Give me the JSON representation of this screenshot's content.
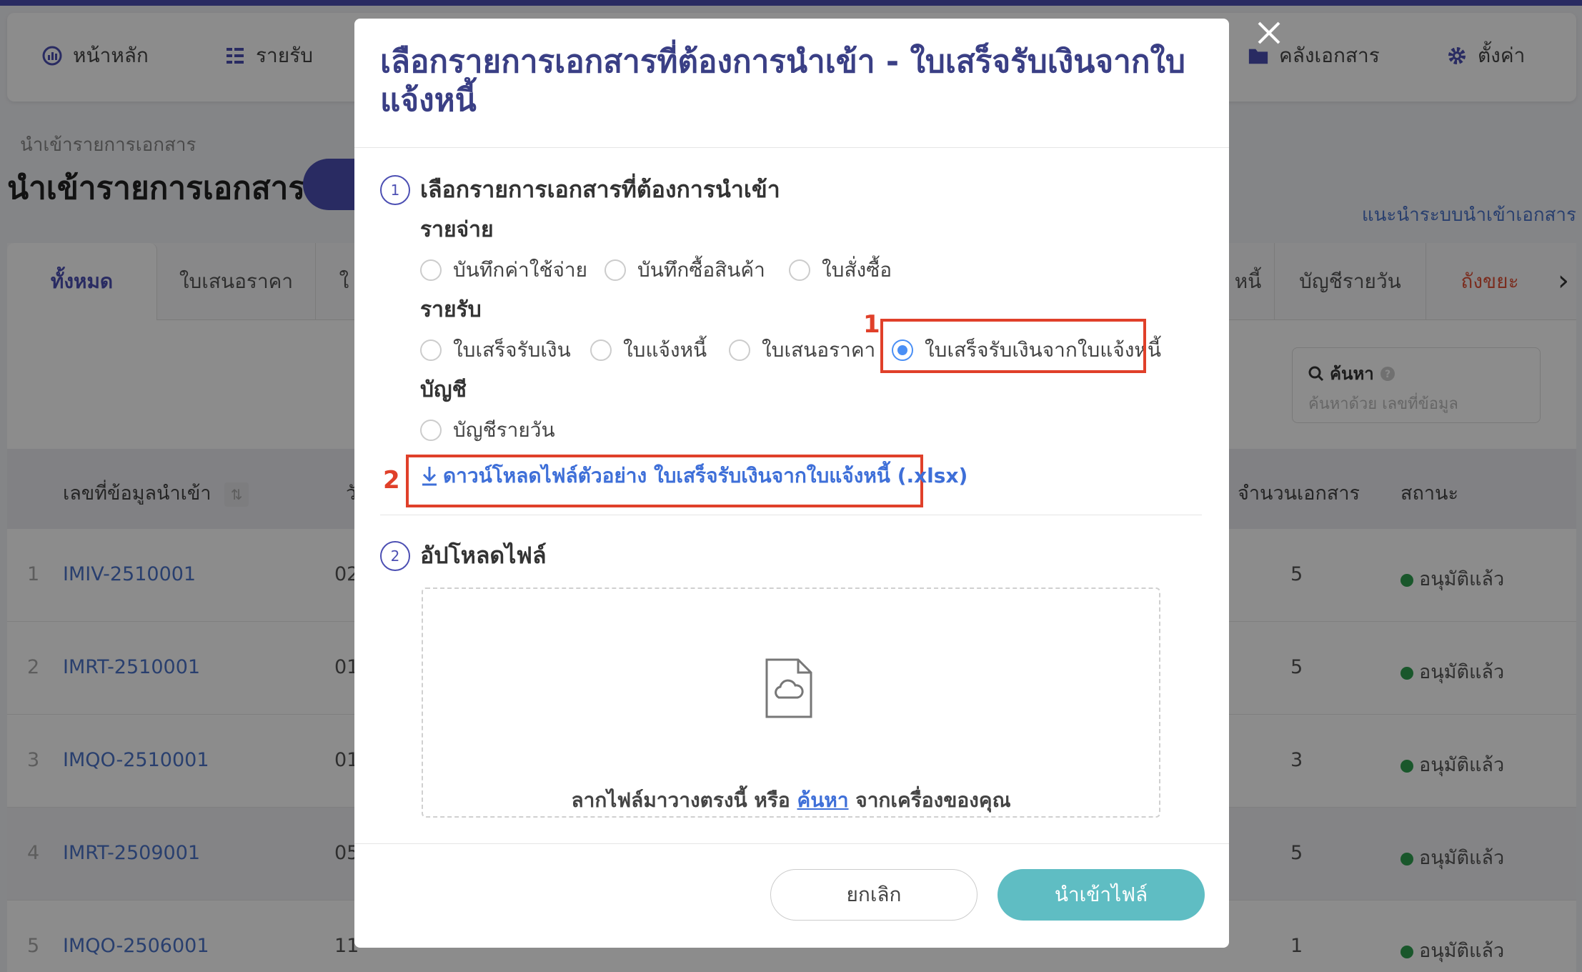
{
  "nav": {
    "items": [
      {
        "label": "หน้าหลัก",
        "icon": "dashboard-icon"
      },
      {
        "label": "รายรับ",
        "icon": "income-list-icon"
      },
      {
        "label": "คลังเอกสาร",
        "icon": "folder-icon"
      },
      {
        "label": "ตั้งค่า",
        "icon": "gear-icon"
      }
    ]
  },
  "page": {
    "breadcrumb": "นำเข้ารายการเอกสาร",
    "title": "นำเข้ารายการเอกสาร",
    "guide_link": "แนะนำระบบนำเข้าเอกสาร"
  },
  "tabs": {
    "items": [
      "ทั้งหมด",
      "ใบเสนอราคา",
      "ใ",
      "หนี้",
      "บัญชีรายวัน",
      "ถังขยะ"
    ],
    "active": "ทั้งหมด"
  },
  "search": {
    "label": "ค้นหา",
    "placeholder": "ค้นหาด้วย เลขที่ข้อมูล"
  },
  "table": {
    "headers": {
      "doc_no": "เลขที่ข้อมูลนำเข้า",
      "date": "วั",
      "count": "จำนวนเอกสาร",
      "status": "สถานะ"
    },
    "rows": [
      {
        "num": "1",
        "doc_no": "IMIV-2510001",
        "date": "02",
        "count": "5",
        "status": "อนุมัติแล้ว"
      },
      {
        "num": "2",
        "doc_no": "IMRT-2510001",
        "date": "01",
        "count": "5",
        "status": "อนุมัติแล้ว"
      },
      {
        "num": "3",
        "doc_no": "IMQO-2510001",
        "date": "01",
        "count": "3",
        "status": "อนุมัติแล้ว"
      },
      {
        "num": "4",
        "doc_no": "IMRT-2509001",
        "date": "05",
        "count": "5",
        "status": "อนุมัติแล้ว"
      },
      {
        "num": "5",
        "doc_no": "IMQO-2506001",
        "date": "11",
        "count": "1",
        "status": "อนุมัติแล้ว"
      }
    ],
    "status_color": "#2e9e4f"
  },
  "modal": {
    "title": "เลือกรายการเอกสารที่ต้องการนำเข้า - ใบเสร็จรับเงินจากใบแจ้งหนี้",
    "step1": {
      "number": "1",
      "label": "เลือกรายการเอกสารที่ต้องการนำเข้า"
    },
    "groups": {
      "expense": {
        "label": "รายจ่าย",
        "options": [
          "บันทึกค่าใช้จ่าย",
          "บันทึกซื้อสินค้า",
          "ใบสั่งซื้อ"
        ]
      },
      "income": {
        "label": "รายรับ",
        "options": [
          "ใบเสร็จรับเงิน",
          "ใบแจ้งหนี้",
          "ใบเสนอราคา",
          "ใบเสร็จรับเงินจากใบแจ้งหนี้"
        ]
      },
      "account": {
        "label": "บัญชี",
        "options": [
          "บัญชีรายวัน"
        ]
      }
    },
    "selected": "ใบเสร็จรับเงินจากใบแจ้งหนี้",
    "annotation_1": "1",
    "annotation_2": "2",
    "download_link": "ดาวน์โหลดไฟล์ตัวอย่าง ใบเสร็จรับเงินจากใบแจ้งหนี้ (.xlsx)",
    "step2": {
      "number": "2",
      "label": "อัปโหลดไฟล์"
    },
    "dropzone": {
      "text_before": "ลากไฟล์มาวางตรงนี้ หรือ",
      "link": "ค้นหา",
      "text_after": "จากเครื่องของคุณ"
    },
    "cancel_label": "ยกเลิก",
    "import_label": "นำเข้าไฟล์"
  },
  "colors": {
    "accent": "#4c4fb3",
    "highlight": "#e0402a",
    "import_button": "#5fbdc3",
    "link": "#3e6fd8"
  }
}
